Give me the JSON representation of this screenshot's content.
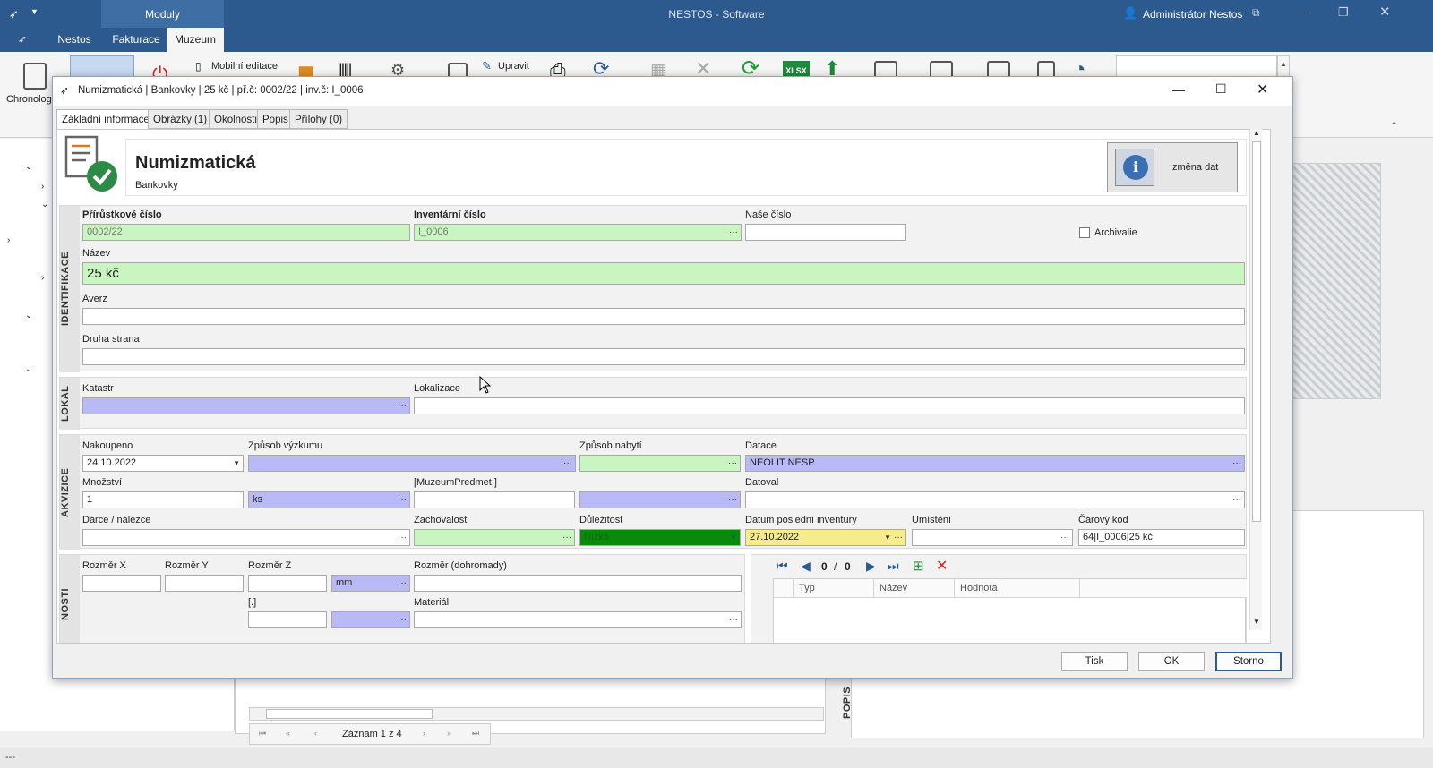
{
  "app": {
    "title": "NESTOS - Software",
    "modules_label": "Moduly",
    "tabs": [
      "Nestos",
      "Fakturace",
      "Muzeum"
    ],
    "user": "Administrátor Nestos",
    "ribbon": {
      "mobile_edit": "Mobilní editace",
      "edit": "Upravit",
      "chronology": "Chronolog",
      "xlsx": "XLSX"
    }
  },
  "background": {
    "record_nav": "Záznam 1 z 4",
    "popis_label": "POPIS",
    "status": "---"
  },
  "dialog": {
    "title": "Numizmatická | Bankovky | 25 kč | př.č: 0002/22 | inv.č: I_0006",
    "tabs": [
      "Základní informace",
      "Obrázky (1)",
      "Okolnosti",
      "Popis",
      "Přílohy (0)"
    ],
    "header": {
      "title": "Numizmatická",
      "subtitle": "Bankovky",
      "change_button": "změna dat"
    },
    "identifikace": {
      "section_label": "IDENTIFIKACE",
      "accession_label": "Přírůstkové číslo",
      "accession_value": "0002/22",
      "inventory_label": "Inventární číslo",
      "inventory_value": "I_0006",
      "our_number_label": "Naše číslo",
      "our_number_value": "",
      "archival_label": "Archivalie",
      "name_label": "Název",
      "name_value": "25 kč",
      "obverse_label": "Averz",
      "reverse_label": "Druha strana"
    },
    "lokal": {
      "section_label": "LOKAL",
      "cadastre_label": "Katastr",
      "location_label": "Lokalizace"
    },
    "akvizice": {
      "section_label": "AKVIZICE",
      "bought_label": "Nakoupeno",
      "bought_value": "24.10.2022",
      "research_label": "Způsob výzkumu",
      "acquisition_label": "Způsob nabytí",
      "dating_label": "Datace",
      "dating_value": "NEOLIT NESP.",
      "quantity_label": "Množství",
      "quantity_value": "1",
      "unit_value": "ks",
      "museum_label": "[MuzeumPredmet.]",
      "dated_by_label": "Datoval",
      "donor_label": "Dárce / nálezce",
      "condition_label": "Zachovalost",
      "importance_label": "Důležitost",
      "importance_value": "Nízká",
      "last_inventory_label": "Datum poslední inventury",
      "last_inventory_value": "27.10.2022",
      "placement_label": "Umístění",
      "barcode_label": "Čárový kod",
      "barcode_value": "64|I_0006|25 kč"
    },
    "vlastnosti": {
      "section_label": "NOSTI",
      "size_x_label": "Rozměr X",
      "size_y_label": "Rozměr Y",
      "size_z_label": "Rozměr Z",
      "unit_value": "mm",
      "size_total_label": "Rozměr (dohromady)",
      "bracket_label": "[.]",
      "material_label": "Materiál",
      "nav_current": "0",
      "nav_sep": "/",
      "nav_total": "0",
      "grid_columns": [
        "Typ",
        "Název",
        "Hodnota"
      ]
    },
    "buttons": {
      "print": "Tisk",
      "ok": "OK",
      "cancel": "Storno"
    }
  }
}
